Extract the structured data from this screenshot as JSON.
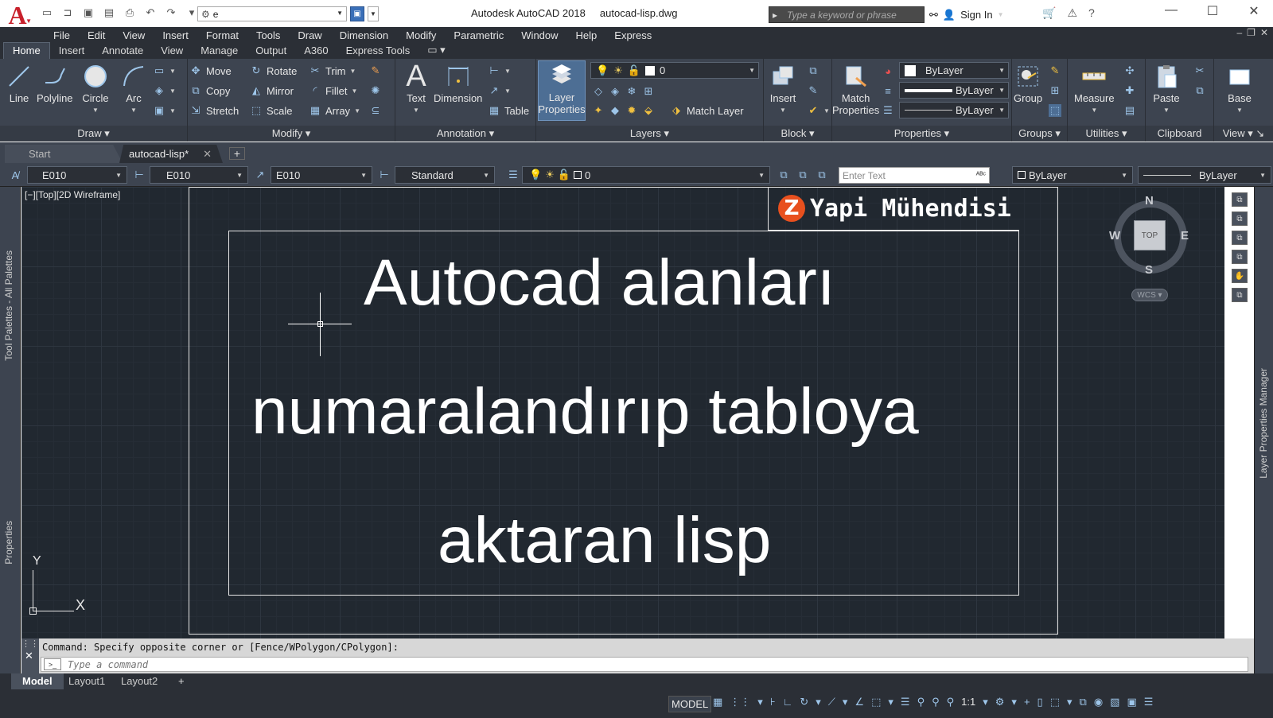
{
  "titlebar": {
    "app_logo": "A",
    "workspace_value": "e",
    "title_app": "Autodesk AutoCAD 2018",
    "title_file": "autocad-lisp.dwg",
    "search_placeholder": "Type a keyword or phrase",
    "signin_label": "Sign In"
  },
  "menubar": {
    "items": [
      "File",
      "Edit",
      "View",
      "Insert",
      "Format",
      "Tools",
      "Draw",
      "Dimension",
      "Modify",
      "Parametric",
      "Window",
      "Help",
      "Express"
    ]
  },
  "ribbon_tabs": [
    "Home",
    "Insert",
    "Annotate",
    "View",
    "Manage",
    "Output",
    "A360",
    "Express Tools"
  ],
  "ribbon": {
    "draw": {
      "label": "Draw",
      "line": "Line",
      "polyline": "Polyline",
      "circle": "Circle",
      "arc": "Arc"
    },
    "modify": {
      "label": "Modify",
      "move": "Move",
      "rotate": "Rotate",
      "trim": "Trim",
      "copy": "Copy",
      "mirror": "Mirror",
      "fillet": "Fillet",
      "stretch": "Stretch",
      "scale": "Scale",
      "array": "Array"
    },
    "annotation": {
      "label": "Annotation",
      "text": "Text",
      "dimension": "Dimension",
      "table": "Table"
    },
    "layers": {
      "label": "Layers",
      "layer_properties_1": "Layer",
      "layer_properties_2": "Properties",
      "current_layer": "0",
      "match_layer": "Match Layer"
    },
    "block": {
      "label": "Block",
      "insert": "Insert"
    },
    "properties": {
      "label": "Properties",
      "match_1": "Match",
      "match_2": "Properties",
      "color": "ByLayer",
      "lineweight": "ByLayer",
      "linetype": "ByLayer"
    },
    "groups": {
      "label": "Groups",
      "group": "Group"
    },
    "utilities": {
      "label": "Utilities",
      "measure": "Measure"
    },
    "clipboard": {
      "label": "Clipboard",
      "paste": "Paste"
    },
    "view": {
      "label": "View",
      "base": "Base"
    }
  },
  "file_tabs": {
    "start": "Start",
    "current": "autocad-lisp*"
  },
  "prop_toolbar": {
    "text_style": "E010",
    "dim_style": "E010",
    "multileader_style": "E010",
    "table_style": "Standard",
    "layer": "0",
    "enter_text_placeholder": "Enter Text",
    "color": "ByLayer",
    "linetype": "ByLayer"
  },
  "palettes": {
    "left_top": "Tool Palettes - All Palettes",
    "left_bottom": "Properties",
    "right": "Layer Properties Manager"
  },
  "drawing": {
    "viewport_label": "[−][Top][2D Wireframe]",
    "brand_logo": "Z",
    "brand_text": "Yapi Mühendisi",
    "line1": "Autocad alanları",
    "line2": "numaralandırıp tabloya",
    "line3": "aktaran lisp",
    "ucs_x": "X",
    "ucs_y": "Y"
  },
  "viewcube": {
    "top": "TOP",
    "n": "N",
    "s": "S",
    "w": "W",
    "e": "E",
    "wcs": "WCS"
  },
  "command": {
    "history": "Command: Specify opposite corner or [Fence/WPolygon/CPolygon]:",
    "placeholder": "Type a command"
  },
  "layout_tabs": [
    "Model",
    "Layout1",
    "Layout2"
  ],
  "statusbar": {
    "model": "MODEL",
    "scale": "1:1"
  },
  "colors": {
    "ribbon_bg": "#3d4450",
    "canvas_bg": "#212830",
    "brand_logo": "#e8501e",
    "autocad_red": "#c8202b"
  }
}
